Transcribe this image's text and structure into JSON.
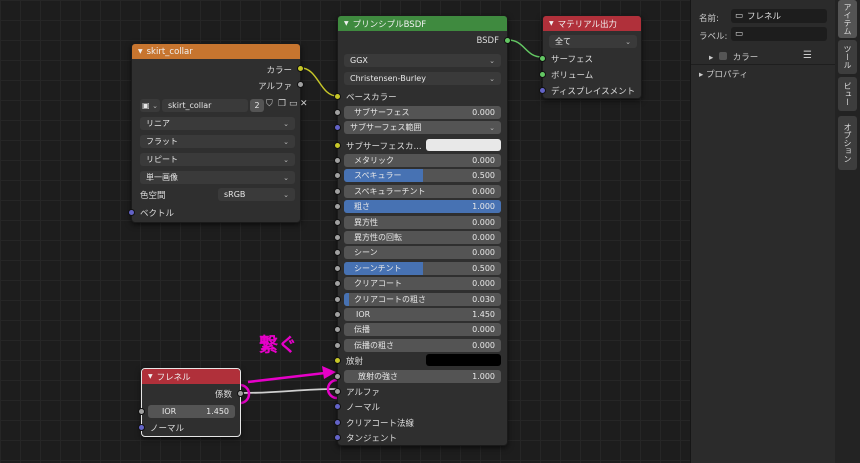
{
  "colors": {
    "header_image": "#c7752f",
    "header_shader": "#3f8a3f",
    "header_output": "#b0303a",
    "header_fresnel": "#b0303a",
    "annotation": "#e600c8",
    "slider_fill": "#4772b3"
  },
  "image_node": {
    "title": "skirt_collar",
    "out_color": "カラー",
    "out_alpha": "アルファ",
    "image_name": "skirt_collar",
    "users": "2",
    "interpolation": "リニア",
    "projection": "フラット",
    "extension": "リピート",
    "source": "単一画像",
    "color_space_label": "色空間",
    "color_space_value": "sRGB",
    "in_vector": "ベクトル"
  },
  "bsdf_node": {
    "title": "プリンシプルBSDF",
    "out_bsdf": "BSDF",
    "distribution": "GGX",
    "subsurface_method": "Christensen-Burley",
    "base_color": "ベースカラー",
    "rows": [
      {
        "label": "サブサーフェス",
        "value": "0.000",
        "fill": 0
      },
      {
        "label": "サブサーフェス範囲",
        "value": "",
        "fill": 0
      },
      {
        "label": "サブサーフェスカ...",
        "value": "",
        "fill": 0
      },
      {
        "label": "メタリック",
        "value": "0.000",
        "fill": 0
      },
      {
        "label": "スペキュラー",
        "value": "0.500",
        "fill": 0.5
      },
      {
        "label": "スペキュラーチント",
        "value": "0.000",
        "fill": 0
      },
      {
        "label": "粗さ",
        "value": "1.000",
        "fill": 1
      },
      {
        "label": "異方性",
        "value": "0.000",
        "fill": 0
      },
      {
        "label": "異方性の回転",
        "value": "0.000",
        "fill": 0
      },
      {
        "label": "シーン",
        "value": "0.000",
        "fill": 0
      },
      {
        "label": "シーンチント",
        "value": "0.500",
        "fill": 0.5
      },
      {
        "label": "クリアコート",
        "value": "0.000",
        "fill": 0
      },
      {
        "label": "クリアコートの粗さ",
        "value": "0.030",
        "fill": 0.03
      },
      {
        "label": "IOR",
        "value": "1.450",
        "fill": 0
      },
      {
        "label": "伝播",
        "value": "0.000",
        "fill": 0
      },
      {
        "label": "伝播の粗さ",
        "value": "0.000",
        "fill": 0
      }
    ],
    "emission": "放射",
    "emission_strength_label": "放射の強さ",
    "emission_strength_value": "1.000",
    "alpha": "アルファ",
    "normal": "ノーマル",
    "clearcoat_normal": "クリアコート法線",
    "tangent": "タンジェント"
  },
  "output_node": {
    "title": "マテリアル出力",
    "target": "全て",
    "surface": "サーフェス",
    "volume": "ボリューム",
    "displacement": "ディスプレイスメント"
  },
  "fresnel_node": {
    "title": "フレネル",
    "out_fac": "係数",
    "ior_label": "IOR",
    "ior_value": "1.450",
    "normal": "ノーマル"
  },
  "annotation": "繋ぐ",
  "side_panel": {
    "name_label": "名前:",
    "name_value": "フレネル",
    "label_label": "ラベル:",
    "color_label": "カラー",
    "properties_label": "プロパティ"
  },
  "tabs": [
    "アイテム",
    "ツール",
    "ビュー",
    "オプション"
  ]
}
